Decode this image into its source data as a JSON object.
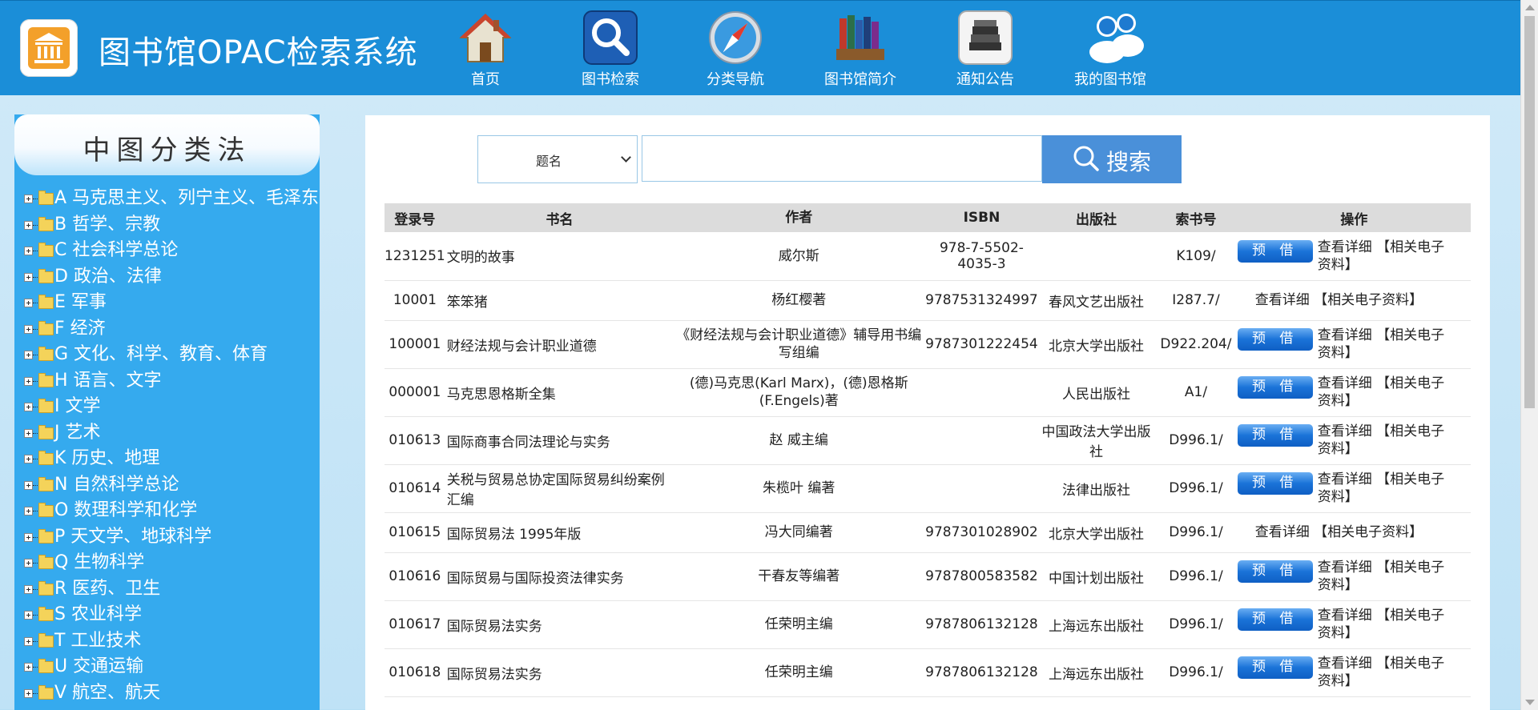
{
  "header": {
    "title": "图书馆OPAC检索系统",
    "nav": [
      {
        "label": "首页",
        "icon": "home-icon"
      },
      {
        "label": "图书检索",
        "icon": "search-icon"
      },
      {
        "label": "分类导航",
        "icon": "compass-icon"
      },
      {
        "label": "图书馆简介",
        "icon": "books-icon"
      },
      {
        "label": "通知公告",
        "icon": "notice-icon"
      },
      {
        "label": "我的图书馆",
        "icon": "users-icon"
      }
    ]
  },
  "sidebar": {
    "title": "中图分类法",
    "items": [
      "A 马克思主义、列宁主义、毛泽东思想、邓小平理论",
      "B 哲学、宗教",
      "C 社会科学总论",
      "D 政治、法律",
      "E 军事",
      "F 经济",
      "G 文化、科学、教育、体育",
      "H 语言、文字",
      "I 文学",
      "J 艺术",
      "K 历史、地理",
      "N 自然科学总论",
      "O 数理科学和化学",
      "P 天文学、地球科学",
      "Q 生物科学",
      "R 医药、卫生",
      "S 农业科学",
      "T 工业技术",
      "U 交通运输",
      "V 航空、航天"
    ]
  },
  "search": {
    "field_selected": "题名",
    "input_value": "",
    "button_label": "搜索"
  },
  "table": {
    "headers": [
      "登录号",
      "书名",
      "作者",
      "ISBN",
      "出版社",
      "索书号",
      "操作"
    ],
    "borrow_label": "预 借",
    "detail_label": "查看详细 【相关电子资料】",
    "rows": [
      {
        "id": "1231251",
        "title": "文明的故事",
        "author": "威尔斯",
        "isbn": "978-7-5502-4035-3",
        "publisher": "",
        "call_no": "K109/",
        "borrow": true
      },
      {
        "id": "10001",
        "title": "笨笨猪",
        "author": "杨红樱著",
        "isbn": "9787531324997",
        "publisher": "春风文艺出版社",
        "call_no": "I287.7/",
        "borrow": false
      },
      {
        "id": "100001",
        "title": "财经法规与会计职业道德",
        "author": "《财经法规与会计职业道德》辅导用书编写组编",
        "isbn": "9787301222454",
        "publisher": "北京大学出版社",
        "call_no": "D922.204/",
        "borrow": true
      },
      {
        "id": "000001",
        "title": "马克思恩格斯全集",
        "author": "(德)马克思(Karl Marx)，(德)恩格斯(F.Engels)著",
        "isbn": "",
        "publisher": "人民出版社",
        "call_no": "A1/",
        "borrow": true
      },
      {
        "id": "010613",
        "title": "国际商事合同法理论与实务",
        "author": "赵 威主编",
        "isbn": "",
        "publisher": "中国政法大学出版社",
        "call_no": "D996.1/",
        "borrow": true
      },
      {
        "id": "010614",
        "title": "关税与贸易总协定国际贸易纠纷案例汇编",
        "author": "朱榄叶 编著",
        "isbn": "",
        "publisher": "法律出版社",
        "call_no": "D996.1/",
        "borrow": true
      },
      {
        "id": "010615",
        "title": "国际贸易法 1995年版",
        "author": "冯大同编著",
        "isbn": "9787301028902",
        "publisher": "北京大学出版社",
        "call_no": "D996.1/",
        "borrow": false
      },
      {
        "id": "010616",
        "title": "国际贸易与国际投资法律实务",
        "author": "干春友等编著",
        "isbn": "9787800583582",
        "publisher": "中国计划出版社",
        "call_no": "D996.1/",
        "borrow": true
      },
      {
        "id": "010617",
        "title": "国际贸易法实务",
        "author": "任荣明主编",
        "isbn": "9787806132128",
        "publisher": "上海远东出版社",
        "call_no": "D996.1/",
        "borrow": true
      },
      {
        "id": "010618",
        "title": "国际贸易法实务",
        "author": "任荣明主编",
        "isbn": "9787806132128",
        "publisher": "上海远东出版社",
        "call_no": "D996.1/",
        "borrow": true
      }
    ]
  }
}
